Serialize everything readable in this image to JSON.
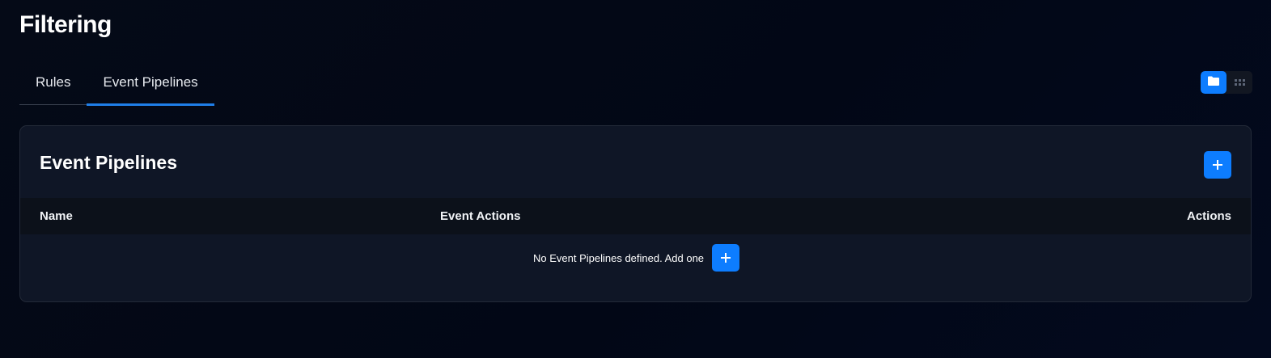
{
  "page": {
    "title": "Filtering"
  },
  "tabs": [
    {
      "label": "Rules",
      "active": false
    },
    {
      "label": "Event Pipelines",
      "active": true
    }
  ],
  "view_toggle": {
    "options": [
      {
        "icon": "folder-icon",
        "active": true
      },
      {
        "icon": "grid-icon",
        "active": false
      }
    ]
  },
  "card": {
    "title": "Event Pipelines",
    "add_icon": "plus-icon",
    "columns": [
      "Name",
      "Event Actions",
      "Actions"
    ],
    "empty_message": "No Event Pipelines defined. Add one"
  },
  "colors": {
    "accent": "#0d7dff",
    "tab_underline": "#1f7ee8",
    "card_bg": "#0f1626",
    "header_bg": "#0c111a",
    "page_bg": "#030a1b"
  }
}
